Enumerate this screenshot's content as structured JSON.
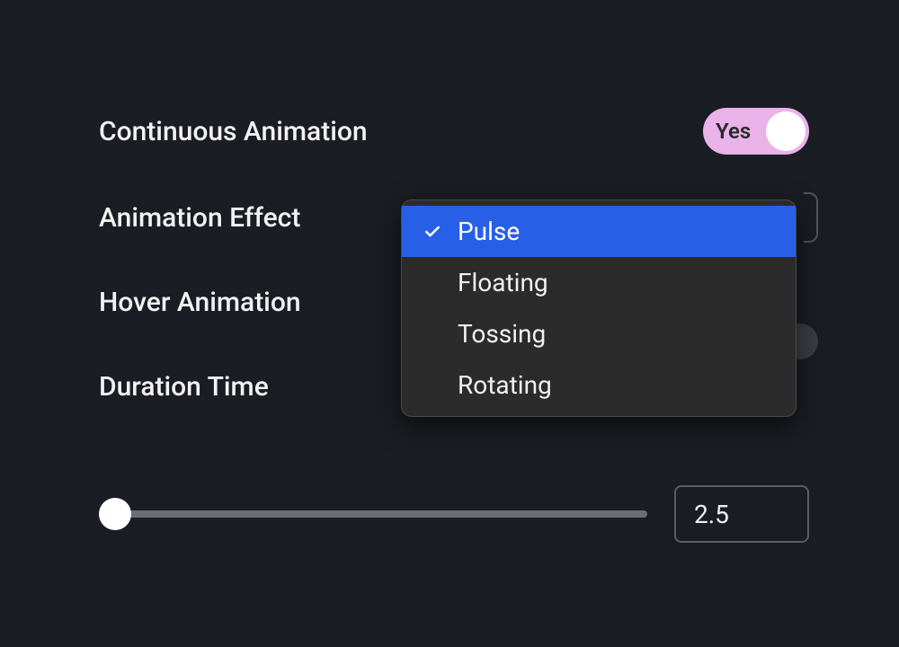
{
  "settings": {
    "continuous_animation": {
      "label": "Continuous Animation",
      "toggle_label": "Yes",
      "enabled": true
    },
    "animation_effect": {
      "label": "Animation Effect",
      "selected": "Pulse",
      "options": [
        "Pulse",
        "Floating",
        "Tossing",
        "Rotating"
      ]
    },
    "hover_animation": {
      "label": "Hover Animation"
    },
    "duration_time": {
      "label": "Duration Time",
      "value": "2.5"
    }
  }
}
